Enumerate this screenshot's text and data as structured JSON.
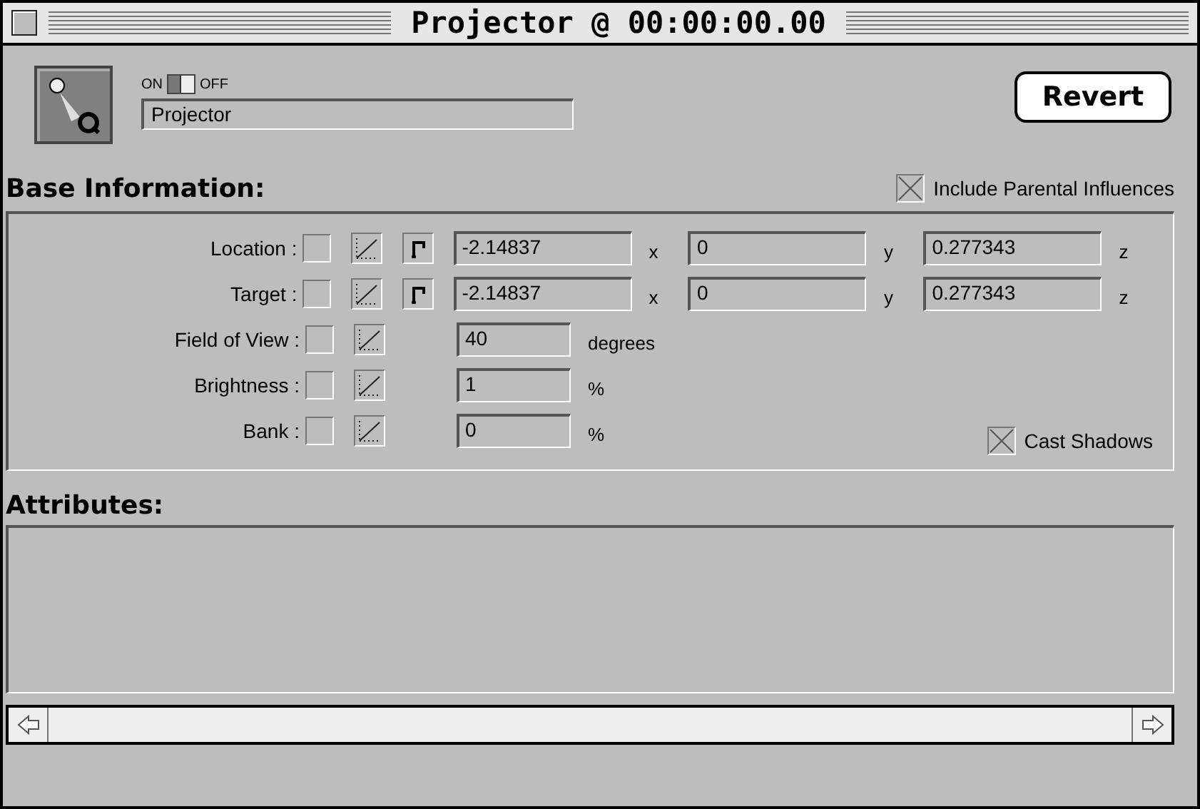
{
  "window": {
    "title": "Projector @ 00:00:00.00"
  },
  "header": {
    "switch": {
      "on_label": "ON",
      "off_label": "OFF",
      "on": true
    },
    "name": "Projector",
    "revert": "Revert"
  },
  "base": {
    "heading": "Base Information:",
    "include_parental": {
      "label": "Include Parental Influences",
      "checked": true
    },
    "rows": [
      {
        "label": "Location :",
        "kind": "vector",
        "checked": false,
        "path": true,
        "fields": [
          {
            "value": "-2.14837",
            "unit": "x"
          },
          {
            "value": "0",
            "unit": "y"
          },
          {
            "value": "0.277343",
            "unit": "z"
          }
        ]
      },
      {
        "label": "Target :",
        "kind": "vector",
        "checked": false,
        "path": true,
        "fields": [
          {
            "value": "-2.14837",
            "unit": "x"
          },
          {
            "value": "0",
            "unit": "y"
          },
          {
            "value": "0.277343",
            "unit": "z"
          }
        ]
      },
      {
        "label": "Field of View :",
        "kind": "scalar",
        "checked": false,
        "path": false,
        "fields": [
          {
            "value": "40",
            "unit": "degrees"
          }
        ]
      },
      {
        "label": "Brightness :",
        "kind": "scalar",
        "checked": false,
        "path": false,
        "fields": [
          {
            "value": "1",
            "unit": "%"
          }
        ]
      },
      {
        "label": "Bank :",
        "kind": "scalar",
        "checked": false,
        "path": false,
        "fields": [
          {
            "value": "0",
            "unit": "%"
          }
        ]
      }
    ],
    "cast_shadows": {
      "label": "Cast Shadows",
      "checked": true
    }
  },
  "attributes": {
    "heading": "Attributes:"
  }
}
